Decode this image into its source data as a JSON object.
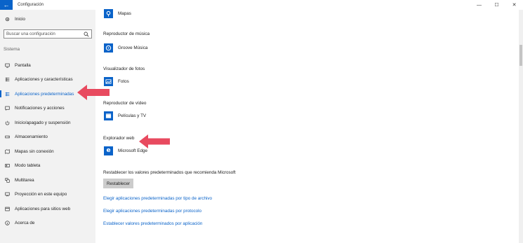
{
  "window": {
    "title": "Configuración",
    "back_icon": "←",
    "minimize_icon": "—",
    "maximize_icon": "☐",
    "close_icon": "✕"
  },
  "sidebar": {
    "home_label": "Inicio",
    "search_placeholder": "Buscar una configuración",
    "section_label": "Sistema",
    "items": [
      {
        "label": "Pantalla",
        "icon": "monitor-icon"
      },
      {
        "label": "Aplicaciones y características",
        "icon": "list-icon"
      },
      {
        "label": "Aplicaciones predeterminadas",
        "icon": "default-apps-icon",
        "active": true
      },
      {
        "label": "Notificaciones y acciones",
        "icon": "notification-icon"
      },
      {
        "label": "Inicio/apagado y suspensión",
        "icon": "power-icon"
      },
      {
        "label": "Almacenamiento",
        "icon": "storage-icon"
      },
      {
        "label": "Mapas sin conexión",
        "icon": "map-icon"
      },
      {
        "label": "Modo tableta",
        "icon": "tablet-icon"
      },
      {
        "label": "Multitarea",
        "icon": "multitask-icon"
      },
      {
        "label": "Proyección en este equipo",
        "icon": "projection-icon"
      },
      {
        "label": "Aplicaciones para sitios web",
        "icon": "web-apps-icon"
      },
      {
        "label": "Acerca de",
        "icon": "info-icon"
      }
    ]
  },
  "main": {
    "maps_app": "Mapas",
    "music_title": "Reproductor de música",
    "music_app": "Groove Música",
    "photo_title": "Visualizador de fotos",
    "photo_app": "Fotos",
    "video_title": "Reproductor de vídeo",
    "video_app": "Películas y TV",
    "web_title": "Explorador web",
    "web_app": "Microsoft Edge",
    "reset_text": "Restablecer los valores predeterminados que recomienda Microsoft",
    "reset_button": "Restablecer",
    "links": [
      "Elegir aplicaciones predeterminadas por tipo de archivo",
      "Elegir aplicaciones predeterminadas por protocolo",
      "Establecer valores predeterminados por aplicación"
    ]
  },
  "colors": {
    "accent": "#0a63c9",
    "sidebar_bg": "#f2f2f2",
    "annotation_arrow": "#e84a5f"
  }
}
